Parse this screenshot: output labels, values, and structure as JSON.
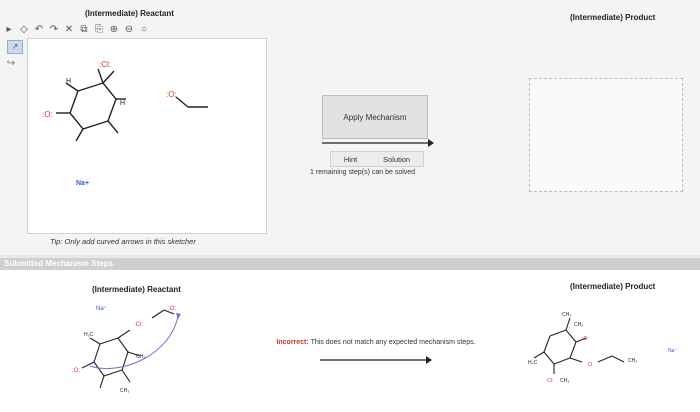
{
  "top": {
    "reactant_title": "(Intermediate) Reactant",
    "product_title": "(Intermediate) Product",
    "apply_button": "Apply Mechanism",
    "hint_label": "Hint",
    "solution_label": "Solution",
    "remaining_text": "1 remaining step(s) can be solved",
    "tip_text": "Tip: Only add curved arrows in this sketcher",
    "sodium_label": "Na+"
  },
  "toolbar_icons": [
    "select-icon",
    "eraser-icon",
    "undo-icon",
    "redo-icon",
    "delete-icon",
    "copy-icon",
    "paste-icon",
    "zoom-in-icon",
    "zoom-out-icon",
    "zoom-fit-icon"
  ],
  "submitted": {
    "header": "Submitted Mechanism Steps",
    "reactant_title": "(Intermediate) Reactant",
    "product_title": "(Intermediate) Product",
    "status_label": "Incorrect:",
    "status_message": "This does not match any expected mechanism steps."
  },
  "colors": {
    "oxygen": "#d23b2b",
    "sodium": "#3b5bdb",
    "arrow": "#6f6fd6",
    "incorrect": "#c0392b"
  }
}
